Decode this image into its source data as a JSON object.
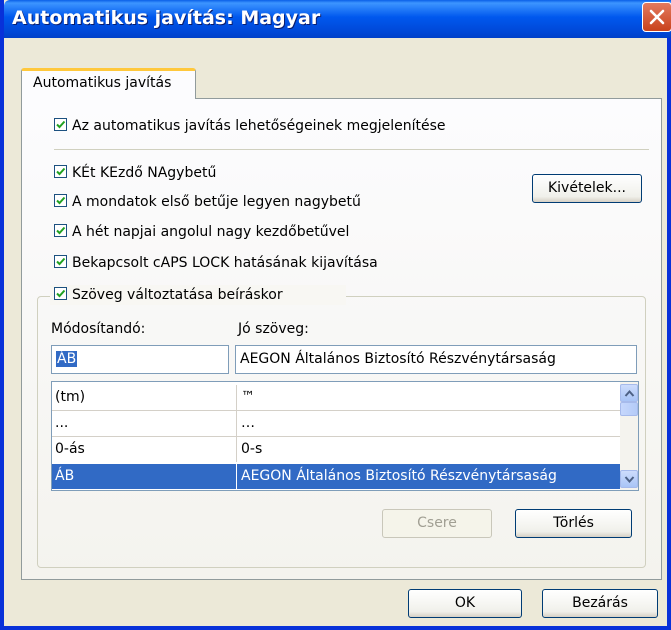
{
  "window": {
    "title": "Automatikus javítás: Magyar"
  },
  "tab": {
    "label": "Automatikus javítás"
  },
  "options": {
    "show_buttons": {
      "label": "Az automatikus javítás lehetőségeinek megjelenítése",
      "checked": true
    },
    "two_initial_caps": {
      "label": "KÉt KEzdő NAgybetű",
      "checked": true
    },
    "capitalize_sentences": {
      "label": "A mondatok első betűje legyen nagybetű",
      "checked": true
    },
    "capitalize_days": {
      "label": "A hét napjai angolul nagy kezdőbetűvel",
      "checked": true
    },
    "caps_lock_fix": {
      "label": "Bekapcsolt cAPS LOCK hatásának kijavítása",
      "checked": true
    },
    "replace_text": {
      "label": "Szöveg változtatása beíráskor",
      "checked": true
    }
  },
  "buttons": {
    "exceptions": "Kivételek...",
    "replace": "Csere",
    "delete": "Törlés",
    "ok": "OK",
    "close": "Bezárás"
  },
  "fields": {
    "replace_label": "Módosítandó:",
    "with_label": "Jó szöveg:",
    "replace_value": "ÁB",
    "with_value": "AEGON Általános Biztosító Részvénytársaság"
  },
  "list": {
    "rows": [
      {
        "from": "(tm)",
        "to": "™"
      },
      {
        "from": "...",
        "to": "…"
      },
      {
        "from": "0-ás",
        "to": "0-s"
      },
      {
        "from": "ÁB",
        "to": "AEGON Általános Biztosító Részvénytársaság"
      }
    ],
    "selected_index": 3
  },
  "colors": {
    "titlebar": "#0058ee",
    "selection": "#316ac5",
    "dialog_bg": "#ece9d8",
    "check_mark": "#21a121",
    "close_button": "#c9421c"
  },
  "icons": {
    "close": "close-x-icon",
    "scroll_up": "chevron-up-icon",
    "scroll_down": "chevron-down-icon",
    "checkbox": "check-icon"
  }
}
